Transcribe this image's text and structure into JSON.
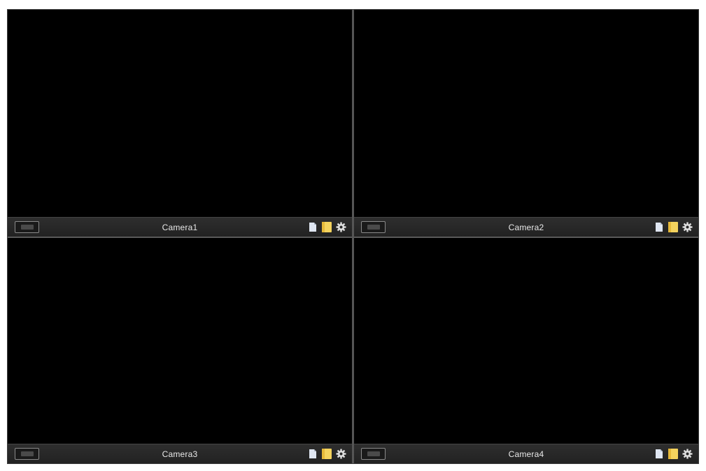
{
  "cameras": [
    {
      "label": "Camera1"
    },
    {
      "label": "Camera2"
    },
    {
      "label": "Camera3"
    },
    {
      "label": "Camera4"
    }
  ],
  "tile_tools": {
    "left_button_icon": "record-icon",
    "icons": [
      "snapshot-icon",
      "folder-icon",
      "gear-icon"
    ]
  },
  "colors": {
    "video_background": "#000000",
    "toolbar_background": "#262626",
    "label_text": "#e8e8e8",
    "snapshot_icon": "#dfe6f2",
    "folder_icon": "#f4d35e",
    "gear_icon": "#e0e0e0"
  }
}
